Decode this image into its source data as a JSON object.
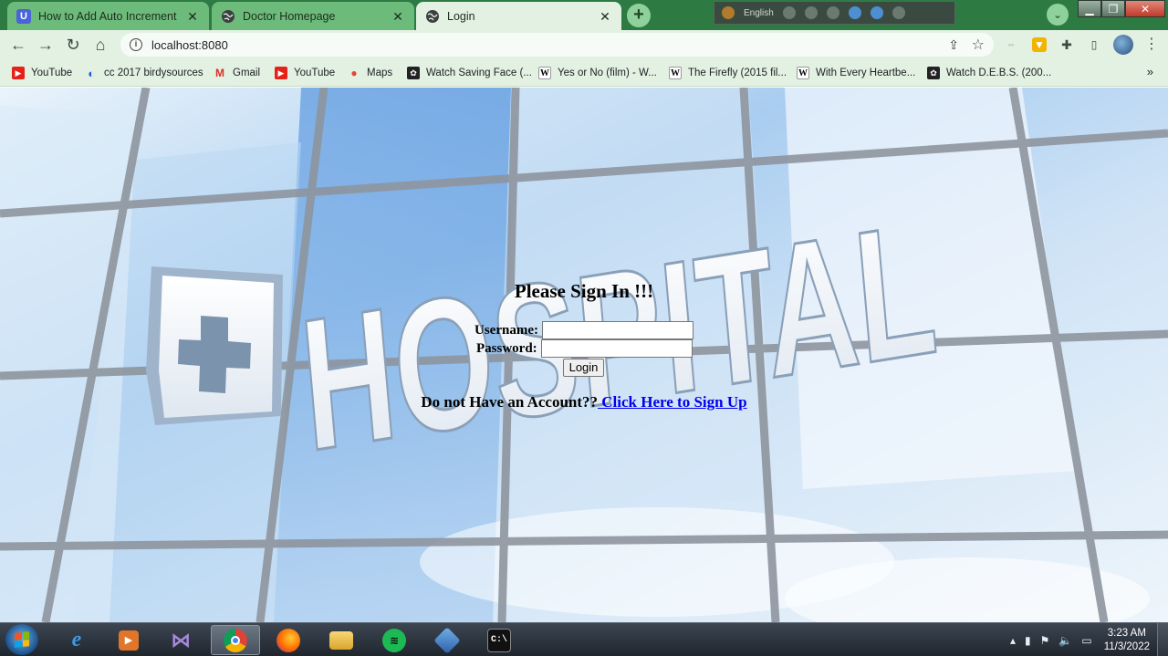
{
  "browser": {
    "tabs": [
      {
        "title": "How to Add Auto Increment Colu",
        "favicon": "U",
        "state": "inactive"
      },
      {
        "title": "Doctor Homepage",
        "favicon": "globe-icon",
        "state": "inactive"
      },
      {
        "title": "Login",
        "favicon": "globe-icon",
        "state": "active"
      }
    ],
    "new_tab_label": "+",
    "ime_language": "English",
    "url": "localhost:8080",
    "bookmarks": [
      {
        "label": "YouTube",
        "icon": "youtube-icon"
      },
      {
        "label": "cc 2017 birdysources",
        "icon": "link-icon"
      },
      {
        "label": "Gmail",
        "icon": "gmail-icon"
      },
      {
        "label": "YouTube",
        "icon": "youtube-icon"
      },
      {
        "label": "Maps",
        "icon": "maps-icon"
      },
      {
        "label": "Watch Saving Face (...",
        "icon": "film-icon"
      },
      {
        "label": "Yes or No (film) - W...",
        "icon": "wikipedia-icon"
      },
      {
        "label": "The Firefly (2015 fil...",
        "icon": "wikipedia-icon"
      },
      {
        "label": "With Every Heartbe...",
        "icon": "wikipedia-icon"
      },
      {
        "label": "Watch D.E.B.S. (200...",
        "icon": "film-icon"
      }
    ],
    "bookmarks_overflow": "»"
  },
  "page": {
    "heading": "Please Sign In !!!",
    "username_label": "Username:",
    "username_value": "",
    "password_label": "Password:",
    "password_value": "",
    "login_button": "Login",
    "signup_prompt": "Do not Have an Account??",
    "signup_link": " Click Here to Sign Up",
    "background_sign_text": "HOSPITAL"
  },
  "taskbar": {
    "apps": [
      "windows-start-icon",
      "internet-explorer-icon",
      "media-player-icon",
      "visual-studio-icon",
      "chrome-icon",
      "firefox-icon",
      "file-explorer-icon",
      "spotify-icon",
      "virtualbox-icon",
      "command-prompt-icon"
    ],
    "active_app": "chrome-icon",
    "time": "3:23 AM",
    "date": "11/3/2022"
  },
  "colors": {
    "tabstrip": "#2d7a43",
    "toolbar": "#e3f1e3",
    "link": "#0000ee"
  }
}
